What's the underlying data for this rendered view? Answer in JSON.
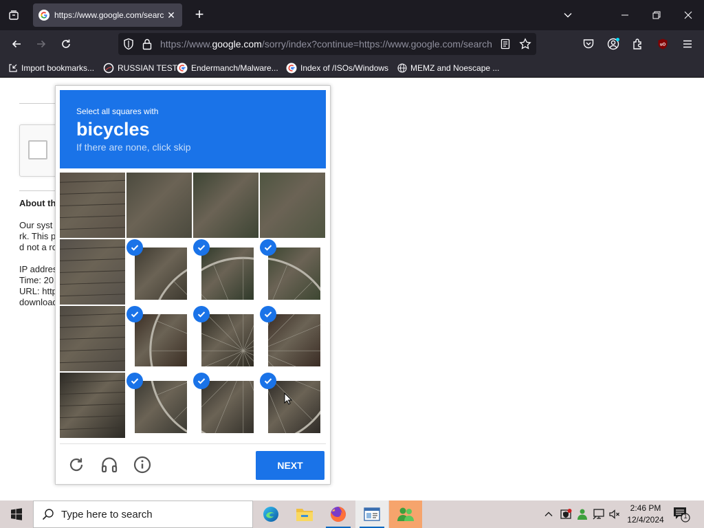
{
  "browser": {
    "tab_title": "https://www.google.com/searc",
    "url_prefix": "https://www.",
    "url_domain": "google.com",
    "url_rest": "/sorry/index?continue=https://www.google.com/search",
    "bookmarks": [
      "Import bookmarks...",
      "RUSSIAN TEST",
      "Endermanch/Malware...",
      "Index of /ISOs/Windows",
      "MEMZ and Noescape ..."
    ]
  },
  "page": {
    "about_heading": "About th",
    "lines_1": [
      "Our syst",
      "rk. This p",
      "d not a ro"
    ],
    "lines_2": [
      "IP addres",
      "Time: 20",
      "URL: http",
      "download"
    ]
  },
  "captcha": {
    "instruction": "Select all squares with",
    "target": "bicycles",
    "hint": "If there are none, click skip",
    "next_label": "NEXT",
    "selected_tiles": [
      5,
      6,
      7,
      9,
      10,
      11,
      13,
      14,
      15
    ]
  },
  "taskbar": {
    "search_placeholder": "Type here to search",
    "time": "2:46 PM",
    "date": "12/4/2024",
    "notification_count": "1"
  },
  "colors": {
    "accent": "#1a73e8",
    "browser_dark": "#1c1b22",
    "browser_toolbar": "#2b2a33"
  }
}
